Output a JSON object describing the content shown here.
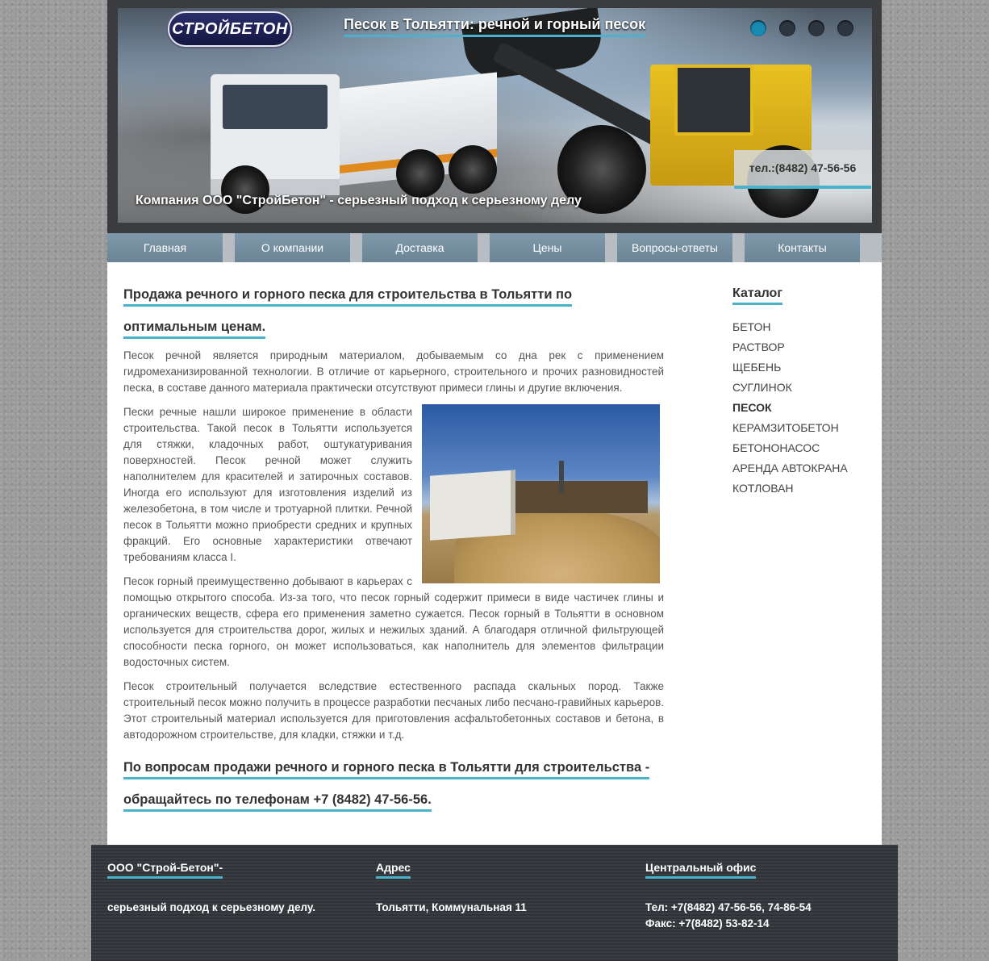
{
  "banner": {
    "logo_text": "СТРОЙБЕТОН",
    "title": "Песок в Тольятти: речной и горный песок",
    "phone": "тел.:(8482) 47-56-56",
    "tagline": "Компания ООО \"СтройБетон\" - серьезный подход к серьезному делу",
    "slides": 4,
    "active_slide": 1,
    "accent_color": "#4ab3c9"
  },
  "nav": {
    "items": [
      "Главная",
      "О компании",
      "Доставка",
      "Цены",
      "Вопросы-ответы",
      "Контакты"
    ]
  },
  "main": {
    "heading": "Продажа речного и горного песка для строительства в Тольятти по оптимальным ценам.",
    "paragraphs": [
      "Песок речной является природным материалом, добываемым со дна рек с применением гидромеханизированной технологии. В отличие от карьерного, строительного и прочих разновидностей песка, в составе данного материала практически отсутствуют примеси глины и другие включения.",
      "Пески речные нашли широкое применение в области строительства. Такой песок в Тольятти используется для стяжки, кладочных работ, оштукатуривания поверхностей. Песок речной может служить наполнителем для красителей и затирочных составов. Иногда его используют для изготовления изделий из железобетона, в том числе и тротуарной плитки. Речной песок в Тольятти можно приобрести средних и крупных фракций. Его основные характеристики отвечают требованиям класса I.",
      "Песок горный преимущественно добывают в карьерах с помощью открытого способа. Из-за того, что песок горный содержит примеси в виде частичек глины и органических веществ, сфера его применения заметно сужается. Песок горный в Тольятти в основном используется для строительства дорог, жилых и нежилых зданий. А благодаря отличной фильтрующей способности песка горного, он может использоваться, как наполнитель для элементов фильтрации водосточных систем.",
      "Песок строительный получается вследствие естественного распада скальных пород. Также строительный песок можно получить в процессе разработки песчаных либо песчано-гравийных карьеров. Этот строительный материал используется для приготовления асфальтобетонных составов и бетона, в автодорожном строительстве, для кладки, стяжки и т.д."
    ],
    "contact_heading": "По вопросам продажи речного и горного песка в Тольятти для строительства - обращайтесь по телефонам +7 (8482) 47-56-56."
  },
  "sidebar": {
    "title": "Каталог",
    "items": [
      "БЕТОН",
      "РАСТВОР",
      "ЩЕБЕНЬ",
      "СУГЛИНОК",
      "ПЕСОК",
      "КЕРАМЗИТОБЕТОН",
      "БЕТОНОНАСОС",
      "АРЕНДА АВТОКРАНА",
      "КОТЛОВАН"
    ],
    "active_item": "ПЕСОК"
  },
  "footer": {
    "company_title": "ООО \"Строй-Бетон\"-",
    "company_text": "серьезный подход к серьезному делу.",
    "address_title": "Адрес",
    "address_text": "Тольятти, Коммунальная 11",
    "office_title": "Центральный офис",
    "office_phone": "Тел: +7(8482) 47-56-56, 74-86-54",
    "office_fax": "Факс: +7(8482) 53-82-14"
  }
}
